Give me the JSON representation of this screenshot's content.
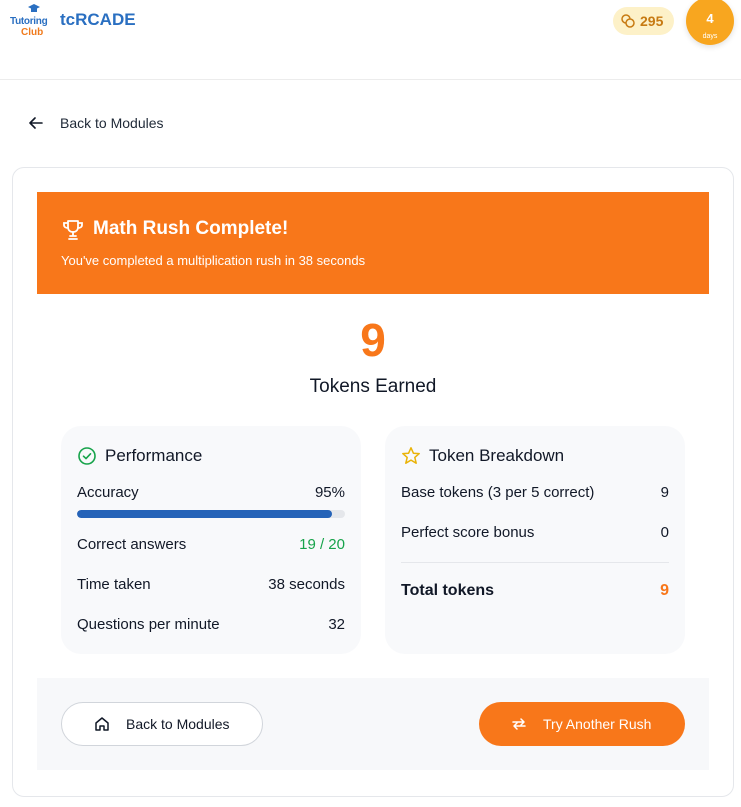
{
  "header": {
    "logo_line1": "Tutoring",
    "logo_line2": "Club",
    "brand": "tcRCADE",
    "coins": "295",
    "coins_icon": "coins-icon",
    "streak_count": "4",
    "streak_unit": "days"
  },
  "nav": {
    "back_label": "Back to Modules",
    "back_icon": "arrow-left-icon"
  },
  "banner": {
    "title": "Math Rush Complete!",
    "subtitle": "You've completed a multiplication rush in 38 seconds",
    "icon": "trophy-icon",
    "color": "#f8771a"
  },
  "score": {
    "value": "9",
    "label": "Tokens Earned"
  },
  "performance": {
    "title": "Performance",
    "icon": "check-circle-icon",
    "accuracy_label": "Accuracy",
    "accuracy_value": "95%",
    "accuracy_fraction": 0.95,
    "rows": [
      {
        "label": "Correct answers",
        "value": "19 / 20"
      },
      {
        "label": "Time taken",
        "value": "38 seconds"
      },
      {
        "label": "Questions per minute",
        "value": "32"
      }
    ]
  },
  "tokens": {
    "title": "Token Breakdown",
    "icon": "star-icon",
    "rows": [
      {
        "label": "Base tokens (3 per 5 correct)",
        "value": "9"
      },
      {
        "label": "Perfect score bonus",
        "value": "0"
      }
    ],
    "total_label": "Total tokens",
    "total_value": "9"
  },
  "footer": {
    "back_label": "Back to Modules",
    "back_icon": "home-icon",
    "rush_label": "Try Another Rush",
    "rush_icon": "repeat-icon"
  },
  "colors": {
    "accent": "#f8771a",
    "brand_blue": "#2a6fc1",
    "success": "#16a34a",
    "bar": "#2563b8"
  }
}
